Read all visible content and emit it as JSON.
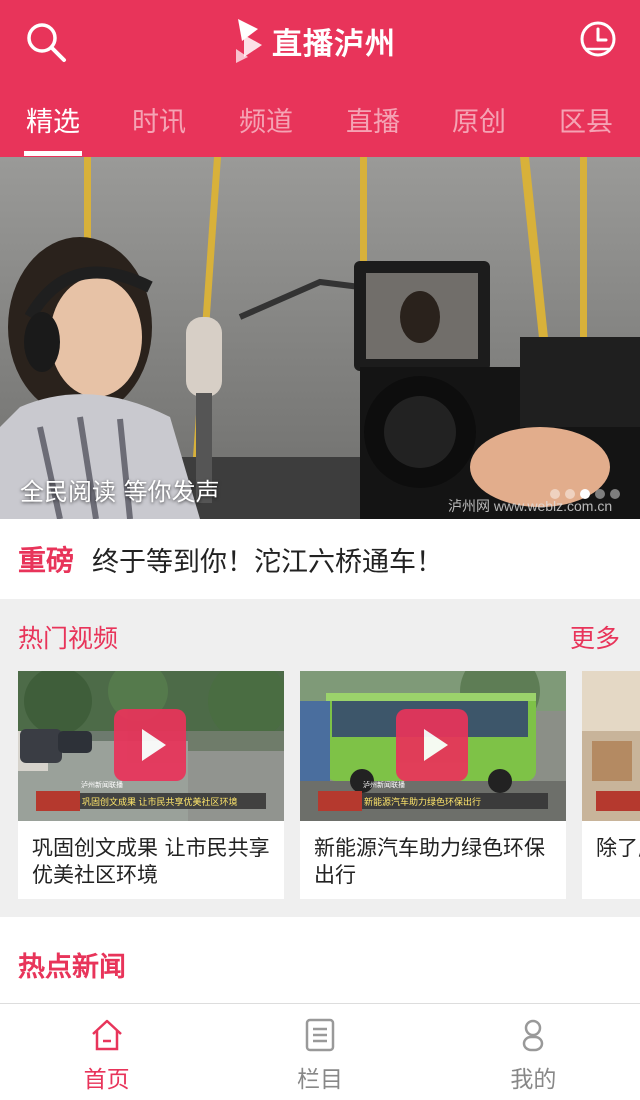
{
  "header": {
    "app_name": "直播泸州",
    "search_icon": "search-icon",
    "history_icon": "clock-icon",
    "accent_color": "#e8345a"
  },
  "tabs": [
    {
      "label": "精选",
      "active": true
    },
    {
      "label": "时讯"
    },
    {
      "label": "频道"
    },
    {
      "label": "直播"
    },
    {
      "label": "原创"
    },
    {
      "label": "区县"
    }
  ],
  "banner": {
    "caption": "全民阅读 等你发声",
    "watermark": "泸州网 www.weblz.com.cn",
    "slide_count": 5,
    "active_slide": 3
  },
  "headline": {
    "badge": "重磅",
    "text": "终于等到你！沱江六桥通车！"
  },
  "hot_videos": {
    "title": "热门视频",
    "more": "更多",
    "items": [
      {
        "title": "巩固创文成果 让市民共享优美社区环境",
        "ticker": "巩固创文成果  让市民共享优美社区环境",
        "channel_tag": "泸州新闻联播"
      },
      {
        "title": "新能源汽车助力绿色环保出行",
        "ticker": "新能源汽车助力绿色环保出行",
        "channel_tag": "泸州新闻联播"
      },
      {
        "title": "除了应该"
      }
    ]
  },
  "hot_news": {
    "title": "热点新闻"
  },
  "bottom_nav": [
    {
      "label": "首页",
      "icon": "home-icon",
      "active": true
    },
    {
      "label": "栏目",
      "icon": "list-icon"
    },
    {
      "label": "我的",
      "icon": "user-icon"
    }
  ]
}
